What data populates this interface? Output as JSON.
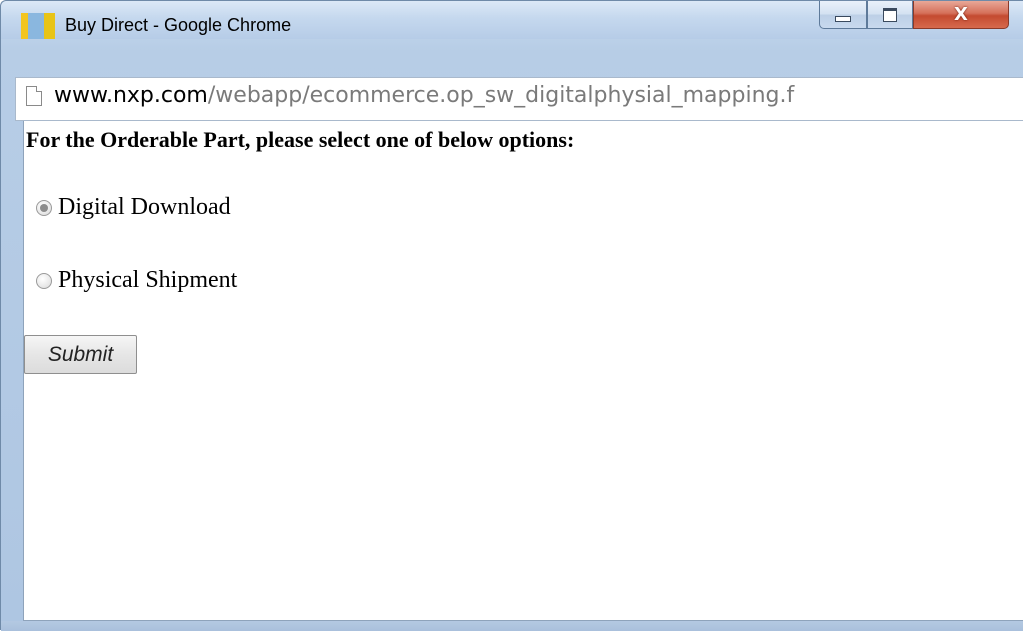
{
  "window": {
    "title": "Buy Direct - Google Chrome",
    "controls": {
      "minimize_icon": "minimize-icon",
      "maximize_icon": "maximize-icon",
      "close_glyph": "X"
    }
  },
  "address_bar": {
    "url_host": "www.nxp.com",
    "url_path": "/webapp/ecommerce.op_sw_digitalphysial_mapping.f",
    "page_icon": "page-icon"
  },
  "form": {
    "heading": "For the Orderable Part, please select one of below options:",
    "options": [
      {
        "label": "Digital Download",
        "checked": true
      },
      {
        "label": "Physical Shipment",
        "checked": false
      }
    ],
    "submit_label": "Submit"
  },
  "colors": {
    "titlebar": "#c5d8ee",
    "close_button": "#c44a30",
    "url_path": "#7a7a7a"
  }
}
